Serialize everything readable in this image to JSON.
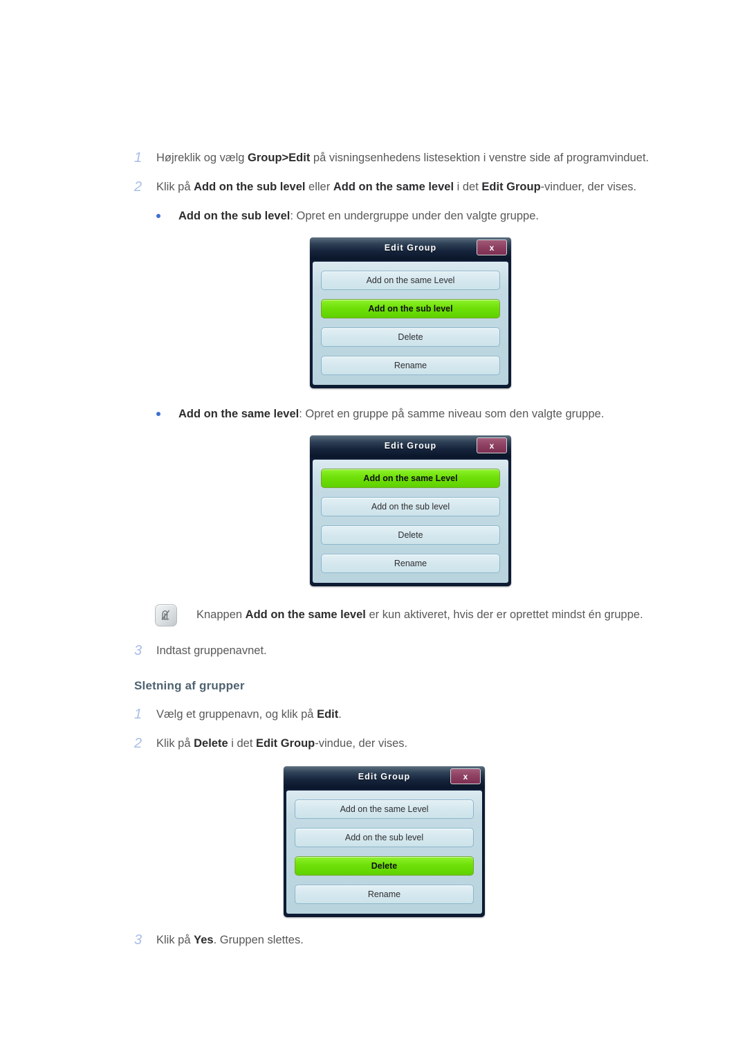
{
  "document": {
    "language": "da",
    "colors": {
      "step_number": "#a8bde9",
      "body_text": "#58585a",
      "heading": "#4e6270",
      "bullet": "#3c6fd0",
      "dialog_active_green": "#6fe008",
      "dialog_titlebar_navy": "#16243c",
      "dialog_close_maroon": "#8f4263",
      "dialog_body_blue": "#bcd6e0"
    }
  },
  "steps_add": [
    {
      "number": "1",
      "text_parts": [
        {
          "t": "Højreklik og vælg ",
          "b": false
        },
        {
          "t": "Group>Edit",
          "b": true
        },
        {
          "t": " på visningsenhedens listesektion i venstre side af programvinduet.",
          "b": false
        }
      ]
    },
    {
      "number": "2",
      "text_parts": [
        {
          "t": "Klik på ",
          "b": false
        },
        {
          "t": "Add on the sub level",
          "b": true
        },
        {
          "t": " eller ",
          "b": false
        },
        {
          "t": "Add on the same level",
          "b": true
        },
        {
          "t": " i det ",
          "b": false
        },
        {
          "t": "Edit Group",
          "b": true
        },
        {
          "t": "-vinduer, der vises.",
          "b": false
        }
      ]
    }
  ],
  "bullets": [
    {
      "text_parts": [
        {
          "t": "Add on the sub level",
          "b": true
        },
        {
          "t": ": Opret en undergruppe under den valgte gruppe.",
          "b": false
        }
      ]
    },
    {
      "text_parts": [
        {
          "t": "Add on the same level",
          "b": true
        },
        {
          "t": ": Opret en gruppe på samme niveau som den valgte gruppe.",
          "b": false
        }
      ]
    }
  ],
  "note": {
    "icon_name": "note-pencil-icon",
    "text_parts": [
      {
        "t": "Knappen ",
        "b": false
      },
      {
        "t": "Add on the same level",
        "b": true
      },
      {
        "t": " er kun aktiveret, hvis der er oprettet mindst én gruppe.",
        "b": false
      }
    ]
  },
  "step_three_add": {
    "number": "3",
    "text_parts": [
      {
        "t": "Indtast gruppenavnet.",
        "b": false
      }
    ]
  },
  "section_heading": "Sletning af grupper",
  "steps_delete": [
    {
      "number": "1",
      "text_parts": [
        {
          "t": "Vælg et gruppenavn, og klik på ",
          "b": false
        },
        {
          "t": "Edit",
          "b": true
        },
        {
          "t": ".",
          "b": false
        }
      ]
    },
    {
      "number": "2",
      "text_parts": [
        {
          "t": "Klik på ",
          "b": false
        },
        {
          "t": "Delete",
          "b": true
        },
        {
          "t": " i det ",
          "b": false
        },
        {
          "t": "Edit Group",
          "b": true
        },
        {
          "t": "-vindue, der vises.",
          "b": false
        }
      ]
    }
  ],
  "step_three_delete": {
    "number": "3",
    "text_parts": [
      {
        "t": "Klik på ",
        "b": false
      },
      {
        "t": "Yes",
        "b": true
      },
      {
        "t": ". Gruppen slettes.",
        "b": false
      }
    ]
  },
  "dialogs": [
    {
      "id": "dialog-sub-level",
      "title": "Edit Group",
      "close_label": "x",
      "buttons": [
        {
          "label": "Add on the same Level",
          "state": "normal"
        },
        {
          "label": "Add on the sub level",
          "state": "active"
        },
        {
          "label": "Delete",
          "state": "normal"
        },
        {
          "label": "Rename",
          "state": "normal"
        }
      ]
    },
    {
      "id": "dialog-same-level",
      "title": "Edit Group",
      "close_label": "x",
      "buttons": [
        {
          "label": "Add on the same Level",
          "state": "active"
        },
        {
          "label": "Add on the sub level",
          "state": "normal"
        },
        {
          "label": "Delete",
          "state": "normal"
        },
        {
          "label": "Rename",
          "state": "normal"
        }
      ]
    },
    {
      "id": "dialog-delete",
      "title": "Edit Group",
      "close_label": "x",
      "buttons": [
        {
          "label": "Add on the same Level",
          "state": "normal"
        },
        {
          "label": "Add on the sub level",
          "state": "normal"
        },
        {
          "label": "Delete",
          "state": "active"
        },
        {
          "label": "Rename",
          "state": "normal"
        }
      ]
    }
  ]
}
